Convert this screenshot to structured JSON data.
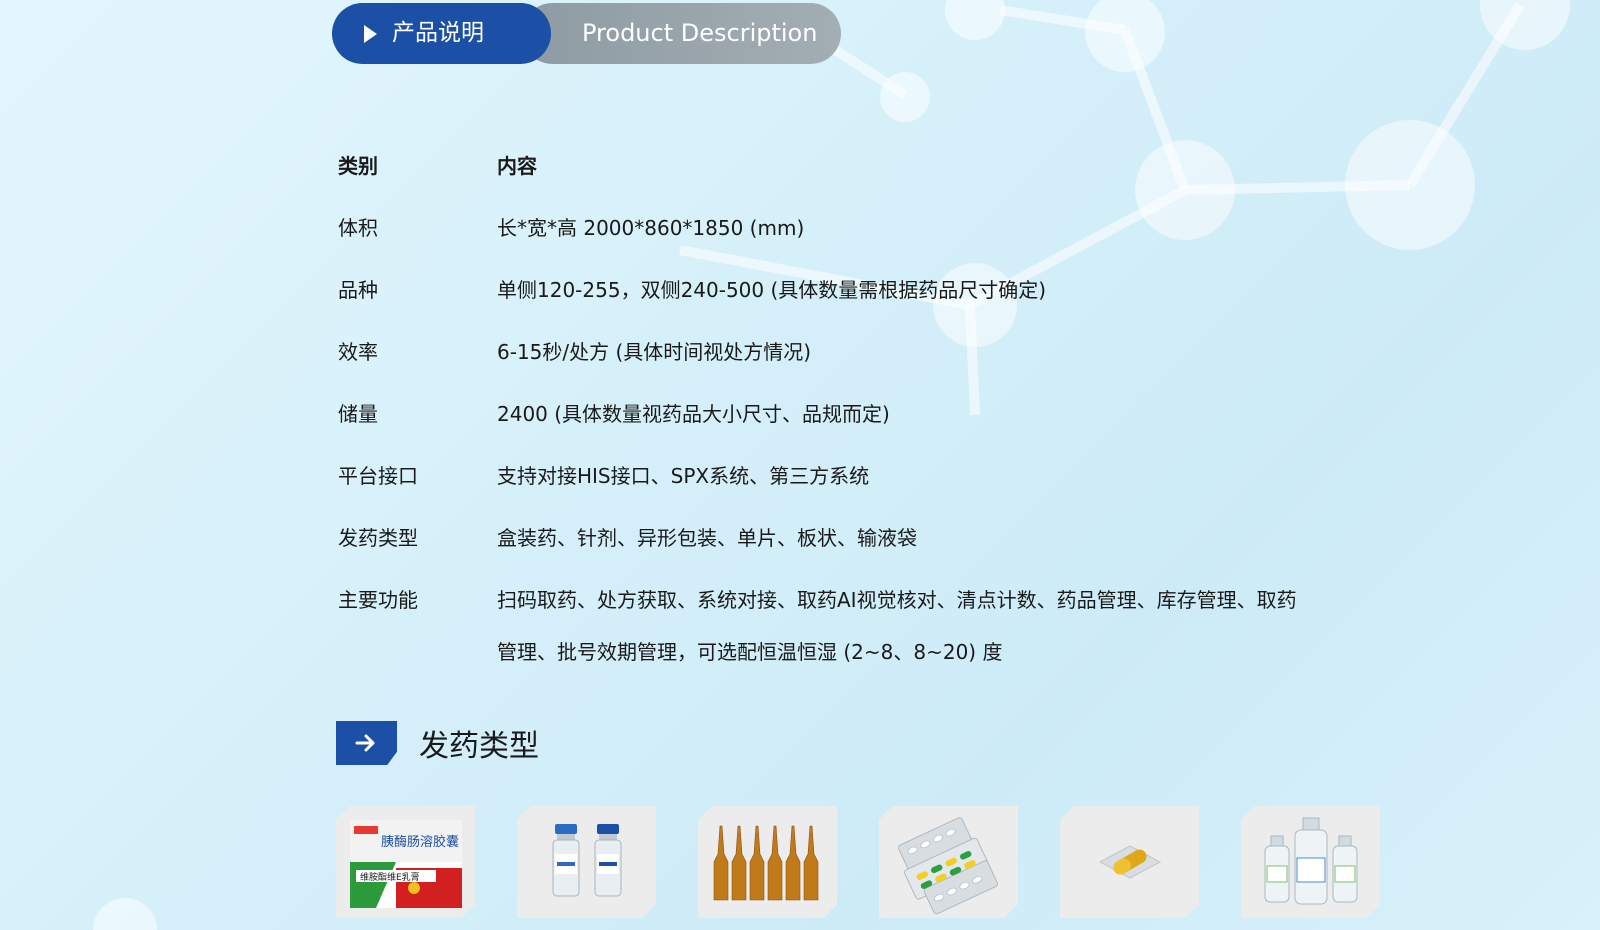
{
  "header": {
    "tab_cn": "产品说明",
    "tab_en": "Product Description"
  },
  "spec_table": {
    "header": {
      "category": "类别",
      "content": "内容"
    },
    "rows": [
      {
        "category": "体积",
        "content": "长*宽*高 2000*860*1850 (mm)"
      },
      {
        "category": "品种",
        "content": "单侧120-255，双侧240-500 (具体数量需根据药品尺寸确定)"
      },
      {
        "category": "效率",
        "content": "6-15秒/处方 (具体时间视处方情况)"
      },
      {
        "category": "储量",
        "content": "2400 (具体数量视药品大小尺寸、品规而定)"
      },
      {
        "category": "平台接口",
        "content": "支持对接HIS接口、SPX系统、第三方系统"
      },
      {
        "category": "发药类型",
        "content": "盒装药、针剂、异形包装、单片、板状、输液袋"
      },
      {
        "category": "主要功能",
        "content": "扫码取药、处方获取、系统对接、取药AI视觉核对、清点计数、药品管理、库存管理、取药",
        "content_cont": "管理、批号效期管理，可选配恒温恒湿 (2~8、8~20) 度"
      }
    ]
  },
  "section": {
    "title": "发药类型",
    "icon": "arrow-right-icon"
  },
  "products": [
    {
      "icon": "medicine-box-image",
      "box_title": "胰酶肠溶胶囊",
      "box_sub": "维胺酯维E乳膏"
    },
    {
      "icon": "vial-image"
    },
    {
      "icon": "ampoule-image"
    },
    {
      "icon": "blister-pack-image"
    },
    {
      "icon": "single-capsule-image"
    },
    {
      "icon": "infusion-bottle-image"
    }
  ],
  "colors": {
    "accent": "#1c4fa6",
    "tab_grey": "#97a3aa",
    "background": "#d6f0fa"
  }
}
